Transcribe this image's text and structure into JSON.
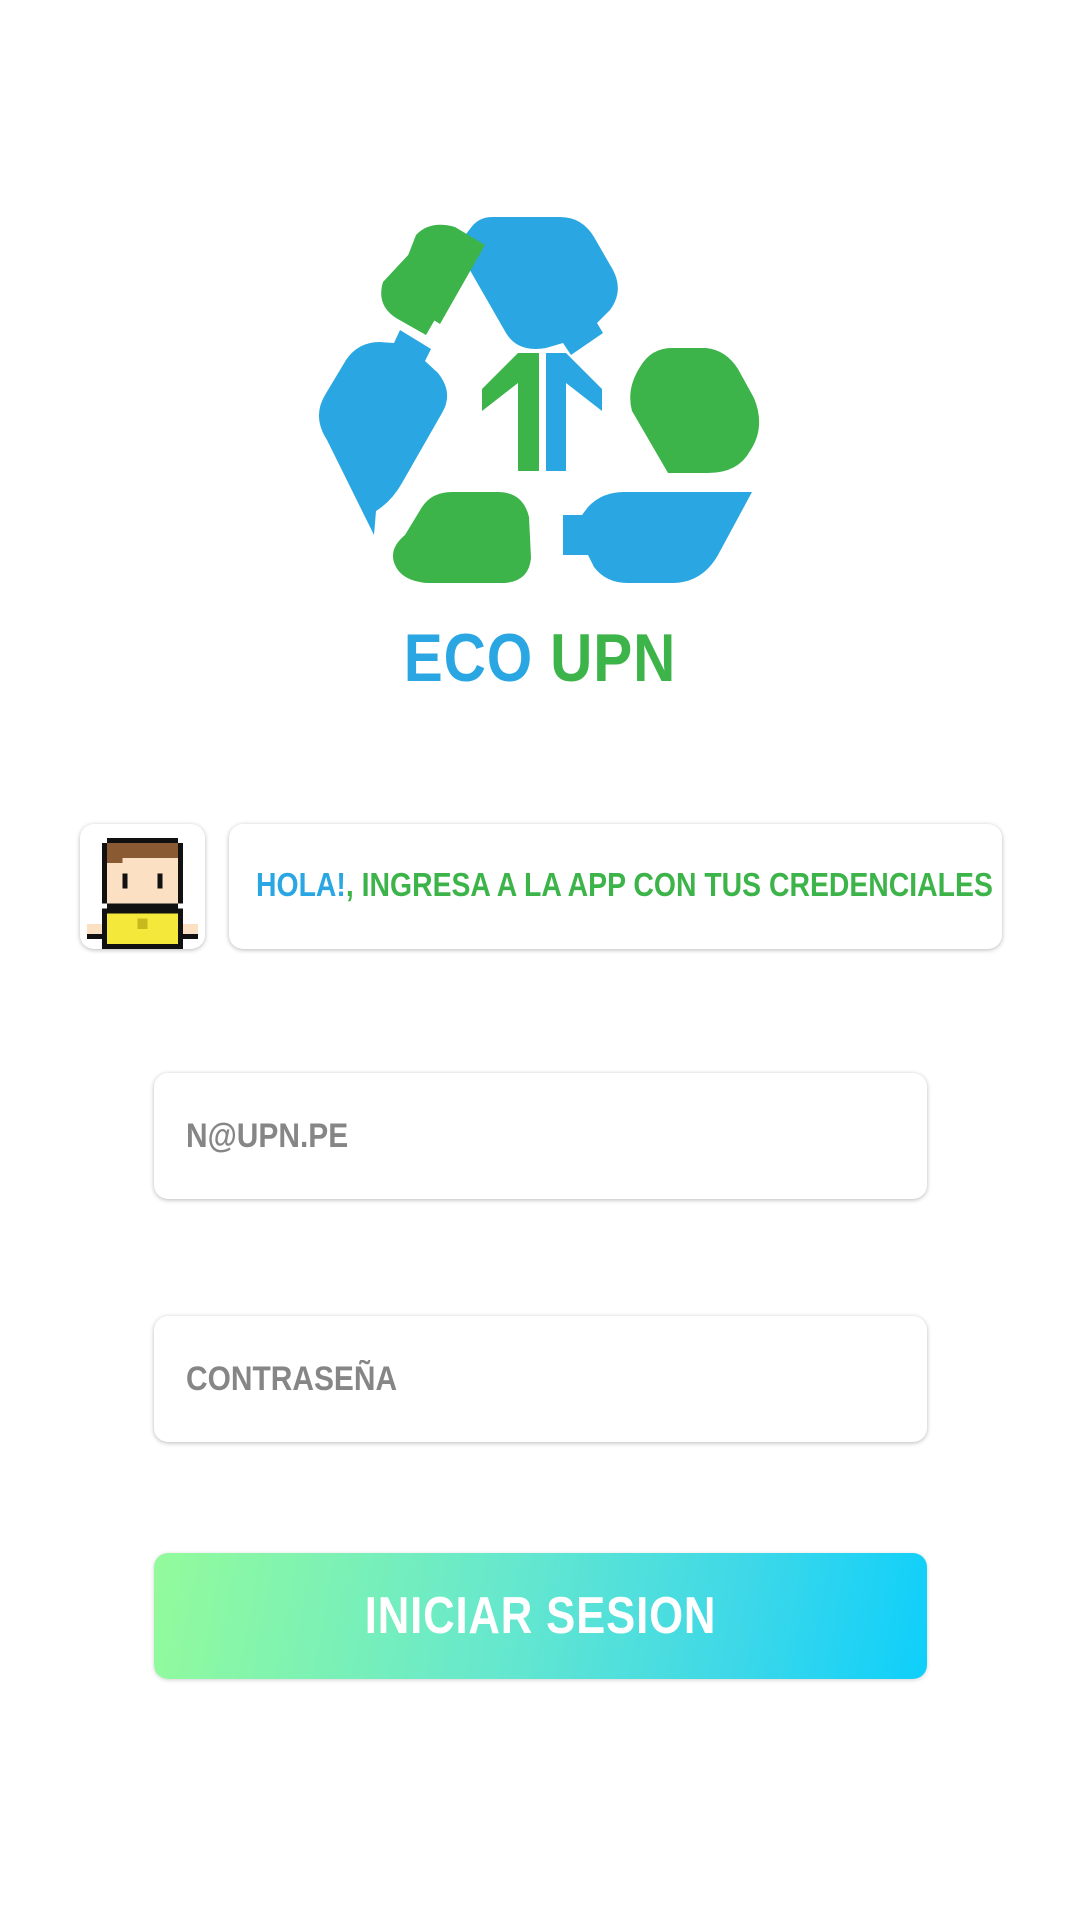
{
  "brand": {
    "word1": "ECO",
    "word2": "UPN"
  },
  "greeting": {
    "highlight": "HOLA!",
    "message": ", INGRESA A LA APP CON TUS CREDENCIALES"
  },
  "login_form": {
    "email_placeholder": "N@UPN.PE",
    "email_value": "",
    "password_placeholder": "CONTRASEÑA",
    "password_value": "",
    "submit_label": "INICIAR SESION"
  },
  "colors": {
    "brand_blue": "#2aa7e2",
    "brand_green": "#3db44a",
    "button_gradient_start": "#93fb9b",
    "button_gradient_end": "#0ecffb",
    "placeholder_gray": "#868686"
  },
  "icons": {
    "logo": "recycle-bottles-logo",
    "avatar": "pixel-boy-avatar"
  }
}
